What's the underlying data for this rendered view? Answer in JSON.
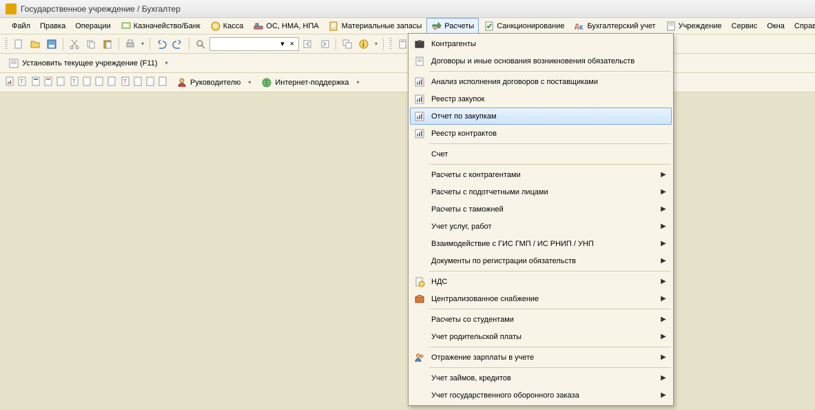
{
  "title": "Государственное учреждение / Бухгалтер",
  "menu": {
    "file": "Файл",
    "edit": "Правка",
    "operations": "Операции",
    "treasury": "Казначейство/Банк",
    "cash": "Касса",
    "os": "ОС, НМА, НПА",
    "materials": "Материальные запасы",
    "calc": "Расчеты",
    "sanction": "Санкционирование",
    "accounting": "Бухгалтерский учет",
    "institution": "Учреждение",
    "service": "Сервис",
    "windows": "Окна",
    "help": "Справка"
  },
  "set_institution": "Установить текущее учреждение (F11)",
  "manager": "Руководителю",
  "internet_support": "Интернет-поддержка",
  "dropdown": [
    {
      "label": "Контрагенты",
      "icon": "contragents",
      "submenu": false
    },
    {
      "label": "Договоры и иные основания возникновения обязательств",
      "icon": "doc",
      "submenu": false
    },
    {
      "label": "Анализ исполнения договоров с поставщиками",
      "icon": "chart",
      "submenu": false
    },
    {
      "label": "Реестр закупок",
      "icon": "chart",
      "submenu": false
    },
    {
      "label": "Отчет по закупкам",
      "icon": "chart",
      "submenu": false,
      "highlight": true
    },
    {
      "label": "Реестр контрактов",
      "icon": "chart",
      "submenu": false
    },
    {
      "label": "Счет",
      "icon": "",
      "submenu": false
    },
    {
      "label": "Расчеты с контрагентами",
      "icon": "",
      "submenu": true
    },
    {
      "label": "Расчеты с подотчетными лицами",
      "icon": "",
      "submenu": true
    },
    {
      "label": "Расчеты с таможней",
      "icon": "",
      "submenu": true
    },
    {
      "label": "Учет услуг, работ",
      "icon": "",
      "submenu": true
    },
    {
      "label": "Взаимодействие с ГИС ГМП / ИС РНИП / УНП",
      "icon": "",
      "submenu": true
    },
    {
      "label": "Документы по регистрации обязательств",
      "icon": "",
      "submenu": true
    },
    {
      "label": "НДС",
      "icon": "nds",
      "submenu": true
    },
    {
      "label": "Централизованное снабжение",
      "icon": "box",
      "submenu": true
    },
    {
      "label": "Расчеты со студентами",
      "icon": "",
      "submenu": true
    },
    {
      "label": "Учет родительской платы",
      "icon": "",
      "submenu": true
    },
    {
      "label": "Отражение зарплаты в учете",
      "icon": "people",
      "submenu": true
    },
    {
      "label": "Учет займов, кредитов",
      "icon": "",
      "submenu": true
    },
    {
      "label": "Учет государственного оборонного заказа",
      "icon": "",
      "submenu": true
    }
  ]
}
